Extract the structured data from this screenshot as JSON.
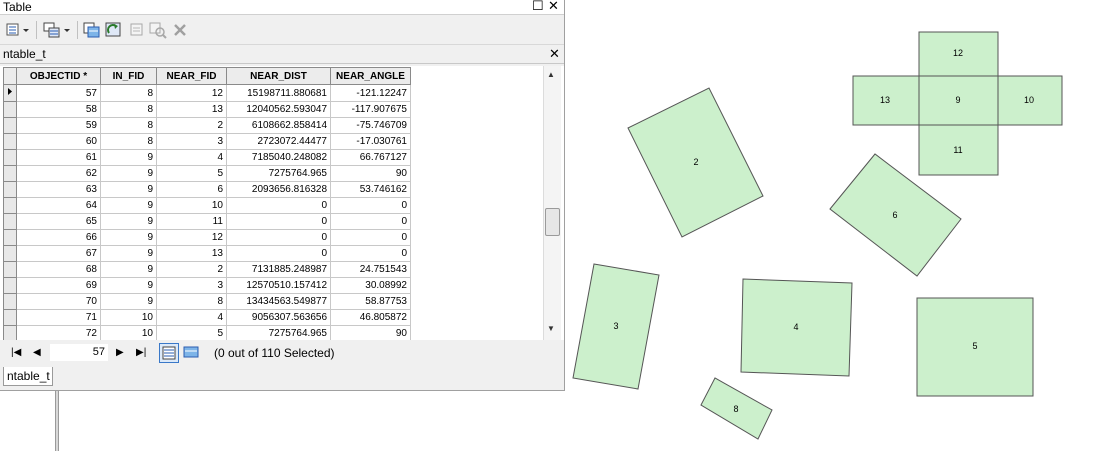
{
  "window": {
    "title": "Table",
    "restore_icon": "restore-icon",
    "close_icon": "close-icon"
  },
  "toolbar": {
    "icons": [
      "table-options-icon",
      "related-tables-icon",
      "select-by-attributes-icon",
      "switch-selection-icon",
      "clear-selection-icon",
      "zoom-to-selected-icon",
      "delete-selected-icon"
    ]
  },
  "tab": {
    "name": "ntable_t"
  },
  "grid": {
    "columns": [
      "OBJECTID *",
      "IN_FID",
      "NEAR_FID",
      "NEAR_DIST",
      "NEAR_ANGLE"
    ],
    "rows": [
      [
        "57",
        "8",
        "12",
        "15198711.880681",
        "-121.12247"
      ],
      [
        "58",
        "8",
        "13",
        "12040562.593047",
        "-117.907675"
      ],
      [
        "59",
        "8",
        "2",
        "6108662.858414",
        "-75.746709"
      ],
      [
        "60",
        "8",
        "3",
        "2723072.44477",
        "-17.030761"
      ],
      [
        "61",
        "9",
        "4",
        "7185040.248082",
        "66.767127"
      ],
      [
        "62",
        "9",
        "5",
        "7275764.965",
        "90"
      ],
      [
        "63",
        "9",
        "6",
        "2093656.816328",
        "53.746162"
      ],
      [
        "64",
        "9",
        "10",
        "0",
        "0"
      ],
      [
        "65",
        "9",
        "11",
        "0",
        "0"
      ],
      [
        "66",
        "9",
        "12",
        "0",
        "0"
      ],
      [
        "67",
        "9",
        "13",
        "0",
        "0"
      ],
      [
        "68",
        "9",
        "2",
        "7131885.248987",
        "24.751543"
      ],
      [
        "69",
        "9",
        "3",
        "12570510.157412",
        "30.08992"
      ],
      [
        "70",
        "9",
        "8",
        "13434563.549877",
        "58.87753"
      ],
      [
        "71",
        "10",
        "4",
        "9056307.563656",
        "46.805872"
      ],
      [
        "72",
        "10",
        "5",
        "7275764.965",
        "90"
      ]
    ],
    "current_row_index": 0
  },
  "navigation": {
    "current_record": "57",
    "status": "(0 out of 110 Selected)"
  },
  "bottom_tab": {
    "label": "ntable_t"
  },
  "map": {
    "fill_color": "#ccf0cc",
    "stroke_color": "#555555",
    "features": [
      "12",
      "13",
      "9",
      "10",
      "11",
      "2",
      "6",
      "3",
      "4",
      "5",
      "8"
    ]
  }
}
